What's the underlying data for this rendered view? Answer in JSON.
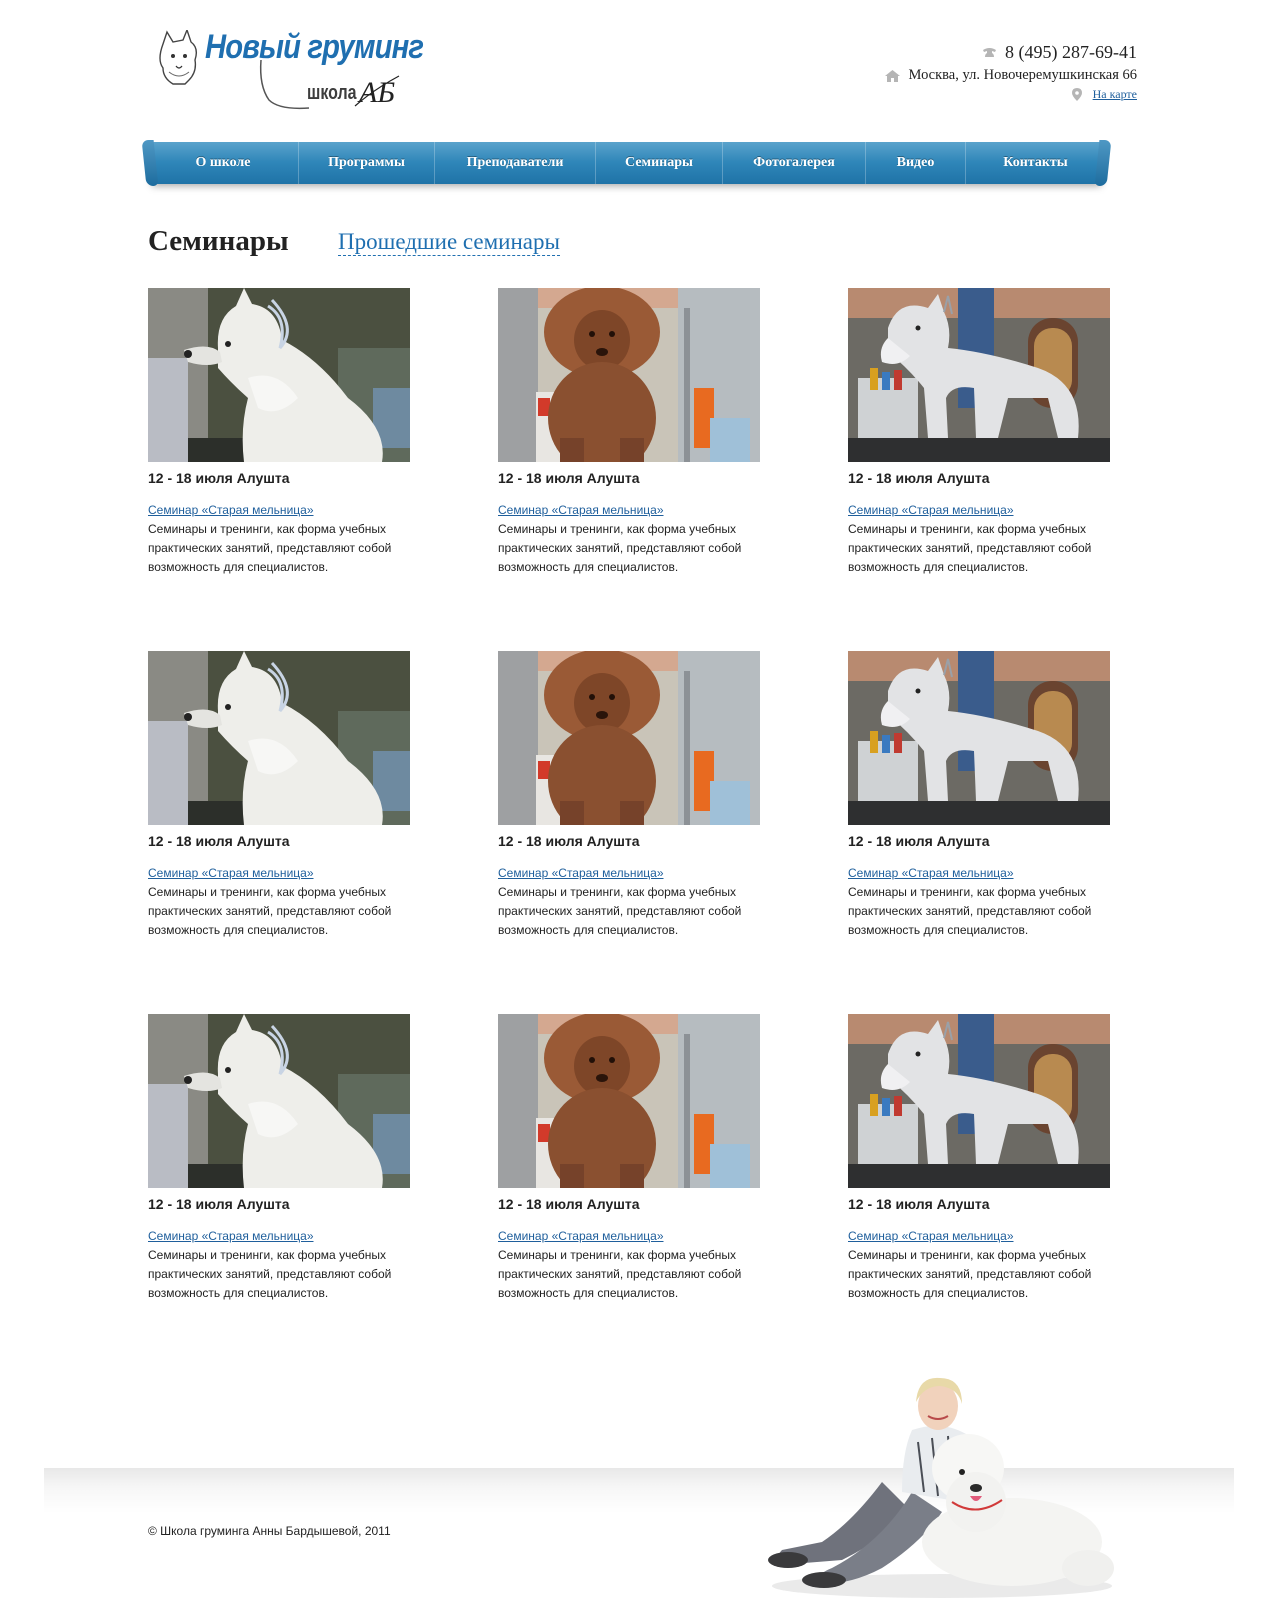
{
  "header": {
    "logo_main": "Новый груминг",
    "logo_sub": "школа",
    "logo_monogram": "АБ",
    "phone": "8 (495) 287-69-41",
    "address": "Москва, ул. Новочеремушкинская 66",
    "map_link": "На карте"
  },
  "nav": {
    "items": [
      {
        "label": "О школе"
      },
      {
        "label": "Программы"
      },
      {
        "label": "Преподаватели"
      },
      {
        "label": "Семинары"
      },
      {
        "label": "Фотогалерея"
      },
      {
        "label": "Видео"
      },
      {
        "label": "Контакты"
      }
    ]
  },
  "page": {
    "title": "Семинары",
    "past_link": "Прошедшие семинары"
  },
  "seminars": [
    {
      "date": "12 - 18 июля Алушта",
      "link": "Семинар «Старая мельница»",
      "description": "Семинары и тренинги, как форма учебных практических занятий, представляют собой возможность для специалистов.",
      "photo": "westie-photo"
    },
    {
      "date": "12 - 18 июля Алушта",
      "link": "Семинар «Старая мельница»",
      "description": "Семинары и тренинги, как форма учебных практических занятий, представляют собой возможность для специалистов.",
      "photo": "poodle-photo"
    },
    {
      "date": "12 - 18 июля Алушта",
      "link": "Семинар «Старая мельница»",
      "description": "Семинары и тренинги, как форма учебных практических занятий, представляют собой возможность для специалистов.",
      "photo": "schnauzer-photo"
    },
    {
      "date": "12 - 18 июля Алушта",
      "link": "Семинар «Старая мельница»",
      "description": "Семинары и тренинги, как форма учебных практических занятий, представляют собой возможность для специалистов.",
      "photo": "westie-photo"
    },
    {
      "date": "12 - 18 июля Алушта",
      "link": "Семинар «Старая мельница»",
      "description": "Семинары и тренинги, как форма учебных практических занятий, представляют собой возможность для специалистов.",
      "photo": "poodle-photo"
    },
    {
      "date": "12 - 18 июля Алушта",
      "link": "Семинар «Старая мельница»",
      "description": "Семинары и тренинги, как форма учебных практических занятий, представляют собой возможность для специалистов.",
      "photo": "schnauzer-photo"
    },
    {
      "date": "12 - 18 июля Алушта",
      "link": "Семинар «Старая мельница»",
      "description": "Семинары и тренинги, как форма учебных практических занятий, представляют собой возможность для специалистов.",
      "photo": "westie-photo"
    },
    {
      "date": "12 - 18 июля Алушта",
      "link": "Семинар «Старая мельница»",
      "description": "Семинары и тренинги, как форма учебных практических занятий, представляют собой возможность для специалистов.",
      "photo": "poodle-photo"
    },
    {
      "date": "12 - 18 июля Алушта",
      "link": "Семинар «Старая мельница»",
      "description": "Семинары и тренинги, как форма учебных практических занятий, представляют собой возможность для специалистов.",
      "photo": "schnauzer-photo"
    }
  ],
  "footer": {
    "copyright": "© Школа груминга Анны Бардышевой, 2011",
    "photo": "groomer-with-poodle-photo"
  },
  "colors": {
    "accent": "#1f6fb0",
    "nav_top": "#5aa3cc",
    "nav_bottom": "#1f73a7",
    "link": "#1f5f9c",
    "text": "#222222"
  },
  "icons": [
    "phone-icon",
    "home-icon",
    "map-pin-icon",
    "logo-dog-icon"
  ]
}
